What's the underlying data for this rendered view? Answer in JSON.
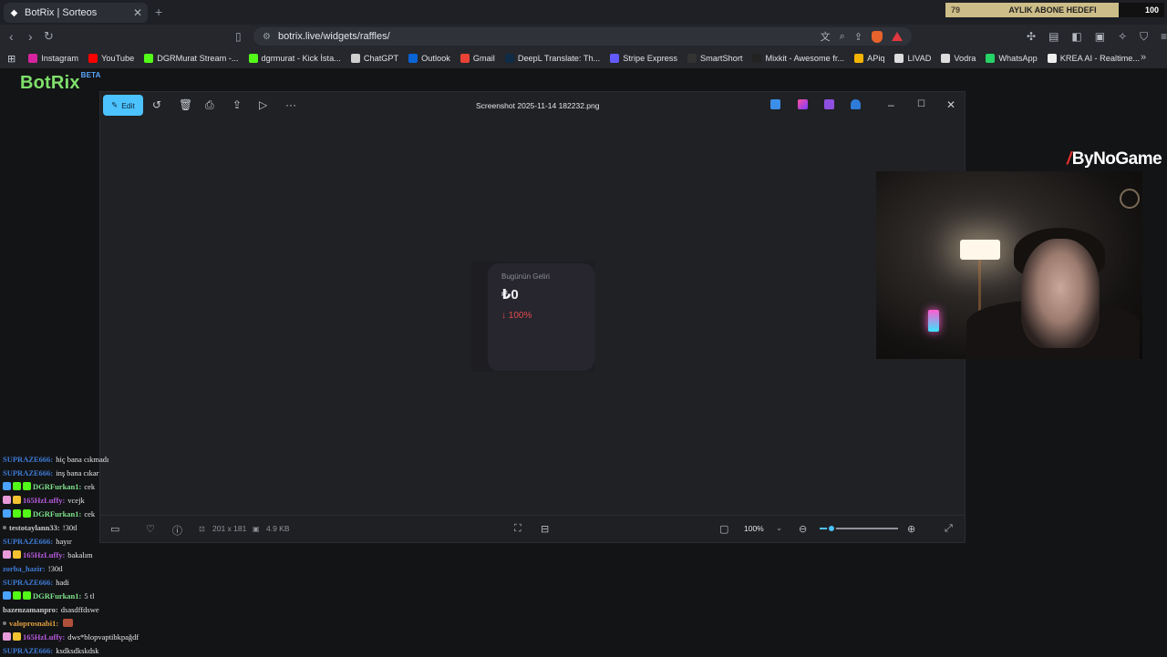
{
  "browser": {
    "tab_title": "BotRix | Sorteos",
    "url": "botrix.live/widgets/raffles/",
    "new_tab": "+"
  },
  "goal": {
    "current": "79",
    "label": "AYLIK ABONE HEDEFI",
    "target": "100",
    "progress_percent": 79
  },
  "bookmarks": [
    {
      "label": "Instagram",
      "color": "#d6249f"
    },
    {
      "label": "YouTube",
      "color": "#ff0000"
    },
    {
      "label": "DGRMurat Stream -...",
      "color": "#53fc18"
    },
    {
      "label": "dgrmurat - Kick İsta...",
      "color": "#53fc18"
    },
    {
      "label": "ChatGPT",
      "color": "#cfcfcf"
    },
    {
      "label": "Outlook",
      "color": "#0a64d6"
    },
    {
      "label": "Gmail",
      "color": "#ea4335"
    },
    {
      "label": "DeepL Translate: Th...",
      "color": "#0f2b46"
    },
    {
      "label": "Stripe Express",
      "color": "#635bff"
    },
    {
      "label": "SmartShort",
      "color": "#333333"
    },
    {
      "label": "Mixkit - Awesome fr...",
      "color": "#222222"
    },
    {
      "label": "APiq",
      "color": "#f5b400"
    },
    {
      "label": "LIVAD",
      "color": "#dddddd"
    },
    {
      "label": "Vodra",
      "color": "#dddddd"
    },
    {
      "label": "WhatsApp",
      "color": "#25d366"
    },
    {
      "label": "KREA AI - Realtime...",
      "color": "#eeeeee"
    }
  ],
  "logo": {
    "name": "BotRix",
    "sup": "BETA"
  },
  "viewer": {
    "edit_label": "Edit",
    "file_name": "Screenshot 2025-11-14 182232.png",
    "dimensions": "201 x 181",
    "file_size": "4.9 KB",
    "zoom": "100%",
    "zoom_fraction": 0.15
  },
  "card": {
    "title": "Bugünün Geliri",
    "value": "₺0",
    "change": "↓ 100%"
  },
  "brand": {
    "name": "ByNoGame"
  },
  "chat": [
    {
      "user": "SUPRAZE666:",
      "text": "hiç bana cıkmadı",
      "color": "#3e7bd6",
      "badges": []
    },
    {
      "user": "SUPRAZE666:",
      "text": "inş bana cıkar",
      "color": "#3e7bd6",
      "badges": []
    },
    {
      "user": "DGRFurkan1:",
      "text": "cek",
      "color": "#7de08a",
      "badges": [
        "#4aa3ff",
        "#53fc18",
        "#53fc18"
      ]
    },
    {
      "user": "165HzLuffy:",
      "text": "vcejk",
      "color": "#b65bdc",
      "badges": [
        "#e79bd8",
        "#f2c230"
      ]
    },
    {
      "user": "DGRFurkan1:",
      "text": "cek",
      "color": "#7de08a",
      "badges": [
        "#4aa3ff",
        "#53fc18",
        "#53fc18"
      ]
    },
    {
      "user": "testotaylann33:",
      "text": "!30tl",
      "color": "#c9c9c9",
      "badges": []
    },
    {
      "user": "SUPRAZE666:",
      "text": "hayır",
      "color": "#3e7bd6",
      "badges": []
    },
    {
      "user": "165HzLuffy:",
      "text": "bakalım",
      "color": "#b65bdc",
      "badges": [
        "#e79bd8",
        "#f2c230"
      ]
    },
    {
      "user": "zorba_hazir:",
      "text": "!30tl",
      "color": "#3e7bd6",
      "badges": []
    },
    {
      "user": "SUPRAZE666:",
      "text": "hadi",
      "color": "#3e7bd6",
      "badges": []
    },
    {
      "user": "DGRFurkan1:",
      "text": "5 tl",
      "color": "#7de08a",
      "badges": [
        "#4aa3ff",
        "#53fc18",
        "#53fc18"
      ]
    },
    {
      "user": "bazenzamanpro:",
      "text": "dsasdffdswe",
      "color": "#c9c9c9",
      "badges": []
    },
    {
      "user": "valoprosnabi1:",
      "text": "",
      "color": "#e0a040",
      "badges": []
    },
    {
      "user": "165HzLuffy:",
      "text": "dws*blopvaptibkpağdf",
      "color": "#b65bdc",
      "badges": [
        "#e79bd8",
        "#f2c230"
      ]
    },
    {
      "user": "SUPRAZE666:",
      "text": "ksdksdkskdsk",
      "color": "#3e7bd6",
      "badges": []
    }
  ]
}
